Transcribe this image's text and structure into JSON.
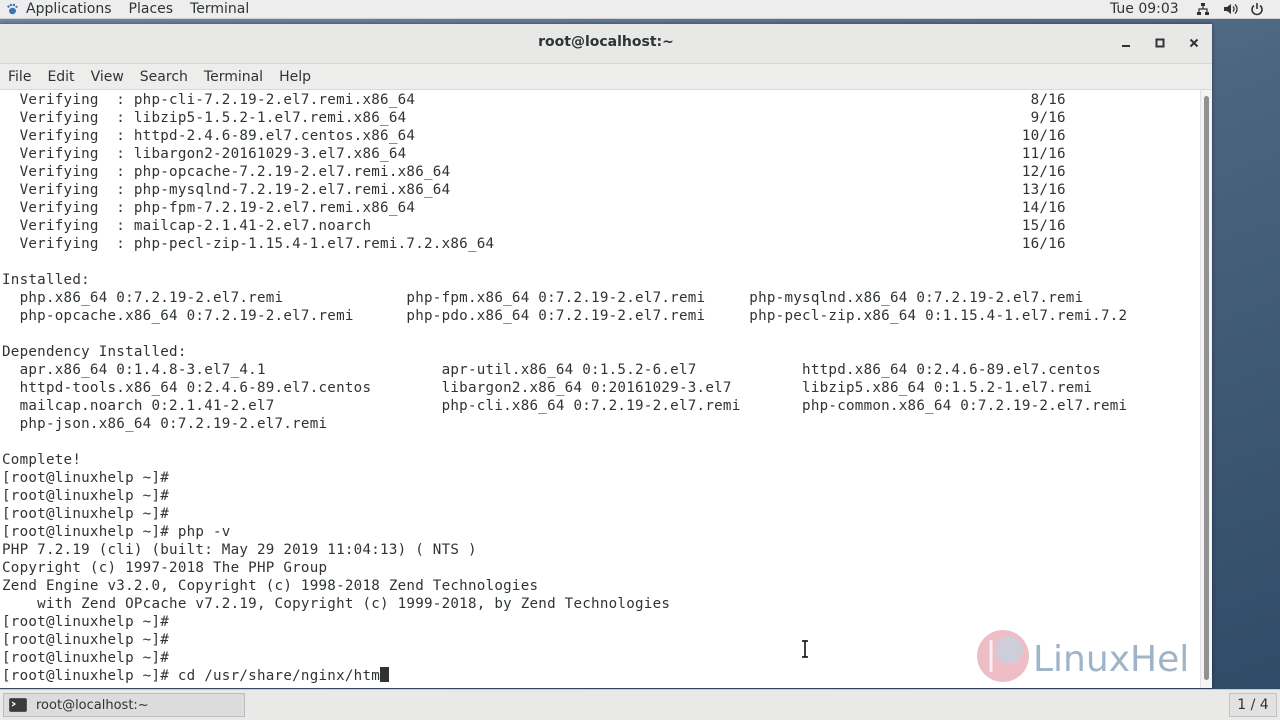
{
  "topbar": {
    "menus": [
      "Applications",
      "Places",
      "Terminal"
    ],
    "clock": "Tue 09:03",
    "status_icons": [
      "network-icon",
      "volume-icon",
      "power-icon"
    ]
  },
  "window": {
    "title": "root@localhost:~",
    "controls": [
      "minimize-icon",
      "maximize-icon",
      "close-icon"
    ],
    "menu": [
      "File",
      "Edit",
      "View",
      "Search",
      "Terminal",
      "Help"
    ]
  },
  "terminal": {
    "lines": [
      "  Verifying  : php-cli-7.2.19-2.el7.remi.x86_64                                                                      8/16",
      "  Verifying  : libzip5-1.5.2-1.el7.remi.x86_64                                                                       9/16",
      "  Verifying  : httpd-2.4.6-89.el7.centos.x86_64                                                                     10/16",
      "  Verifying  : libargon2-20161029-3.el7.x86_64                                                                      11/16",
      "  Verifying  : php-opcache-7.2.19-2.el7.remi.x86_64                                                                 12/16",
      "  Verifying  : php-mysqlnd-7.2.19-2.el7.remi.x86_64                                                                 13/16",
      "  Verifying  : php-fpm-7.2.19-2.el7.remi.x86_64                                                                     14/16",
      "  Verifying  : mailcap-2.1.41-2.el7.noarch                                                                          15/16",
      "  Verifying  : php-pecl-zip-1.15.4-1.el7.remi.7.2.x86_64                                                            16/16",
      "",
      "Installed:",
      "  php.x86_64 0:7.2.19-2.el7.remi              php-fpm.x86_64 0:7.2.19-2.el7.remi     php-mysqlnd.x86_64 0:7.2.19-2.el7.remi",
      "  php-opcache.x86_64 0:7.2.19-2.el7.remi      php-pdo.x86_64 0:7.2.19-2.el7.remi     php-pecl-zip.x86_64 0:1.15.4-1.el7.remi.7.2",
      "",
      "Dependency Installed:",
      "  apr.x86_64 0:1.4.8-3.el7_4.1                    apr-util.x86_64 0:1.5.2-6.el7            httpd.x86_64 0:2.4.6-89.el7.centos",
      "  httpd-tools.x86_64 0:2.4.6-89.el7.centos        libargon2.x86_64 0:20161029-3.el7        libzip5.x86_64 0:1.5.2-1.el7.remi",
      "  mailcap.noarch 0:2.1.41-2.el7                   php-cli.x86_64 0:7.2.19-2.el7.remi       php-common.x86_64 0:7.2.19-2.el7.remi",
      "  php-json.x86_64 0:7.2.19-2.el7.remi",
      "",
      "Complete!",
      "[root@linuxhelp ~]#",
      "[root@linuxhelp ~]#",
      "[root@linuxhelp ~]#",
      "[root@linuxhelp ~]# php -v",
      "PHP 7.2.19 (cli) (built: May 29 2019 11:04:13) ( NTS )",
      "Copyright (c) 1997-2018 The PHP Group",
      "Zend Engine v3.2.0, Copyright (c) 1998-2018 Zend Technologies",
      "    with Zend OPcache v7.2.19, Copyright (c) 1999-2018, by Zend Technologies",
      "[root@linuxhelp ~]#",
      "[root@linuxhelp ~]#",
      "[root@linuxhelp ~]#"
    ],
    "current_prompt": "[root@linuxhelp ~]# cd /usr/share/nginx/htm"
  },
  "taskbar": {
    "window_label": "root@localhost:~",
    "workspace": "1 / 4"
  },
  "watermark": {
    "text": "LinuxHel"
  }
}
